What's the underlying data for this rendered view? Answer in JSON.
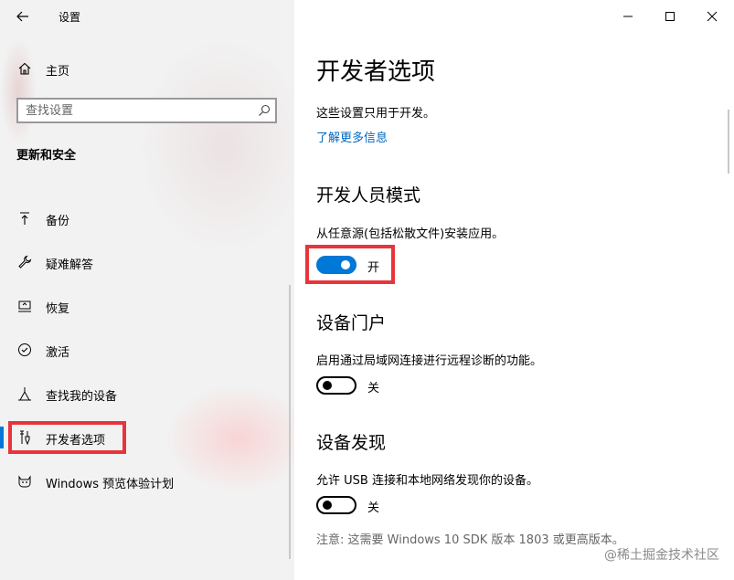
{
  "window": {
    "title": "设置",
    "controls": [
      "minimize-icon",
      "maximize-icon",
      "close-icon"
    ]
  },
  "sidebar": {
    "home_label": "主页",
    "search_placeholder": "查找设置",
    "section_heading": "更新和安全",
    "items": [
      {
        "label": "备份",
        "icon": "backup-arrow-icon"
      },
      {
        "label": "疑难解答",
        "icon": "wrench-icon"
      },
      {
        "label": "恢复",
        "icon": "recovery-icon"
      },
      {
        "label": "激活",
        "icon": "check-circle-icon"
      },
      {
        "label": "查找我的设备",
        "icon": "find-device-icon"
      },
      {
        "label": "开发者选项",
        "icon": "developer-tools-icon",
        "selected": true
      },
      {
        "label": "Windows 预览体验计划",
        "icon": "insider-cat-icon"
      }
    ]
  },
  "main": {
    "title": "开发者选项",
    "intro": "这些设置只用于开发。",
    "learn_more": "了解更多信息",
    "sections": [
      {
        "heading": "开发人员模式",
        "description": "从任意源(包括松散文件)安装应用。",
        "toggle_state": "开",
        "on": true
      },
      {
        "heading": "设备门户",
        "description": "启用通过局域网连接进行远程诊断的功能。",
        "toggle_state": "关",
        "on": false
      },
      {
        "heading": "设备发现",
        "description": "允许 USB 连接和本地网络发现你的设备。",
        "toggle_state": "关",
        "on": false
      }
    ],
    "note": "注意: 这需要 Windows 10 SDK 版本 1803 或更高版本。"
  },
  "watermark": "@稀土掘金技术社区",
  "colors": {
    "accent": "#0078d7",
    "highlight": "#e8343b",
    "link": "#0067c0"
  }
}
